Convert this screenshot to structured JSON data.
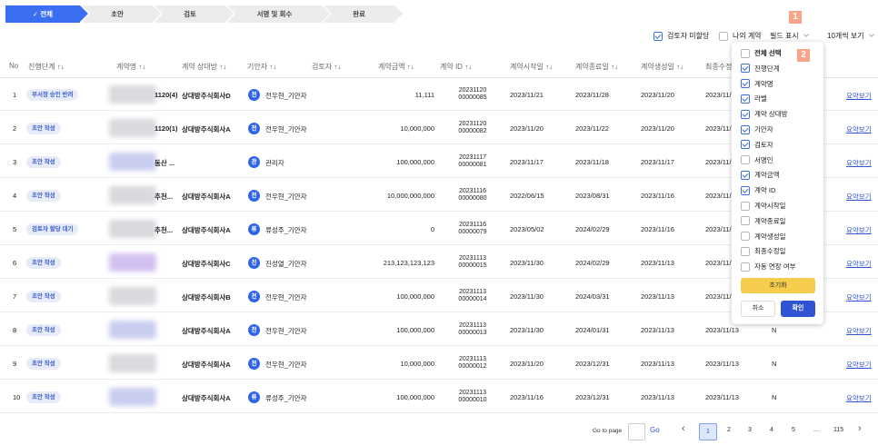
{
  "stepper": {
    "steps": [
      {
        "label": "✓ 전체",
        "active": true
      },
      {
        "label": "초안",
        "active": false
      },
      {
        "label": "검토",
        "active": false
      },
      {
        "label": "서명 및 회수",
        "active": false
      },
      {
        "label": "완료",
        "active": false
      }
    ]
  },
  "toolbar": {
    "unassigned_label": "검토자 미할당",
    "my_contracts_label": "나의 계약",
    "field_display_label": "필드 표시",
    "page_size_label": "10개씩 보기",
    "annotation_1": "1",
    "annotation_2": "2"
  },
  "table": {
    "headers": [
      "No",
      "진행단계 ↑↓",
      "계약명 ↑↓",
      "계약 상대방 ↑↓",
      "기안자 ↑↓",
      "검토자 ↑↓",
      "계약금액 ↑↓",
      "계약 ID ↑↓",
      "계약시작일 ↑↓",
      "계약종료일 ↑↓",
      "계약생성일 ↑↓",
      "최종수정"
    ],
    "rows": [
      {
        "no": "1",
        "stage": "부서장 승인 반려",
        "name": "1120(4)",
        "party": "상대방주식회사D",
        "drafter_initial": "전",
        "drafter": "전우현_기안자",
        "amount": "11,111",
        "id1": "20231120",
        "id2": "00000085",
        "start": "2023/11/21",
        "end": "2023/11/28",
        "created": "2023/11/20",
        "modified": "2023/11/",
        "extra": "",
        "action": "요약보기"
      },
      {
        "no": "2",
        "stage": "초안 작성",
        "name": "1120(1)",
        "party": "상대방주식회사A",
        "drafter_initial": "전",
        "drafter": "전우현_기안자",
        "amount": "10,000,000",
        "id1": "20231120",
        "id2": "00000082",
        "start": "2023/11/20",
        "end": "2023/11/22",
        "created": "2023/11/20",
        "modified": "2023/11/",
        "extra": "",
        "action": "요약보기"
      },
      {
        "no": "3",
        "stage": "초안 작성",
        "name": "동산 ...",
        "party": "",
        "drafter_initial": "관",
        "drafter": "관리자",
        "amount": "100,000,000",
        "id1": "20231117",
        "id2": "00000081",
        "start": "2023/11/17",
        "end": "2023/11/18",
        "created": "2023/11/17",
        "modified": "2023/11/",
        "extra": "",
        "action": "요약보기"
      },
      {
        "no": "4",
        "stage": "초안 작성",
        "name": "추천...",
        "party": "상대방주식회사A",
        "drafter_initial": "전",
        "drafter": "전우현_기안자",
        "amount": "10,000,000,000",
        "id1": "20231116",
        "id2": "00000080",
        "start": "2022/06/15",
        "end": "2023/08/31",
        "created": "2023/11/16",
        "modified": "2023/11/",
        "extra": "",
        "action": "요약보기"
      },
      {
        "no": "5",
        "stage": "검토자 할당 대기",
        "name": "추천...",
        "party": "상대방주식회사A",
        "drafter_initial": "류",
        "drafter": "류성주_기안자",
        "amount": "0",
        "id1": "20231116",
        "id2": "00000079",
        "start": "2023/05/02",
        "end": "2024/02/29",
        "created": "2023/11/16",
        "modified": "2023/11/",
        "extra": "",
        "action": "요약보기"
      },
      {
        "no": "6",
        "stage": "초안 작성",
        "name": "",
        "party": "상대방주식회사C",
        "drafter_initial": "진",
        "drafter": "진성열_기안자",
        "amount": "213,123,123,123",
        "id1": "20231113",
        "id2": "00000015",
        "start": "2023/11/30",
        "end": "2024/02/29",
        "created": "2023/11/13",
        "modified": "2023/11/",
        "extra": "",
        "action": "요약보기"
      },
      {
        "no": "7",
        "stage": "초안 작성",
        "name": "",
        "party": "상대방주식회사B",
        "drafter_initial": "전",
        "drafter": "전우현_기안자",
        "amount": "100,000,000",
        "id1": "20231113",
        "id2": "00000014",
        "start": "2023/11/30",
        "end": "2024/03/31",
        "created": "2023/11/13",
        "modified": "2023/11/",
        "extra": "",
        "action": "요약보기"
      },
      {
        "no": "8",
        "stage": "초안 작성",
        "name": "",
        "party": "상대방주식회사A",
        "drafter_initial": "전",
        "drafter": "전우현_기안자",
        "amount": "100,000,000",
        "id1": "20231113",
        "id2": "00000013",
        "start": "2023/11/30",
        "end": "2024/01/31",
        "created": "2023/11/13",
        "modified": "2023/11/13",
        "extra": "N",
        "action": "요약보기"
      },
      {
        "no": "9",
        "stage": "초안 작성",
        "name": "",
        "party": "상대방주식회사A",
        "drafter_initial": "전",
        "drafter": "전우현_기안자",
        "amount": "10,000,000",
        "id1": "20231113",
        "id2": "00000012",
        "start": "2023/11/20",
        "end": "2023/12/31",
        "created": "2023/11/13",
        "modified": "2023/11/13",
        "extra": "N",
        "action": "요약보기"
      },
      {
        "no": "10",
        "stage": "초안 작성",
        "name": "",
        "party": "상대방주식회사A",
        "drafter_initial": "류",
        "drafter": "류성주_기안자",
        "amount": "100,000,000",
        "id1": "20231113",
        "id2": "00000010",
        "start": "2023/11/16",
        "end": "2023/12/31",
        "created": "2023/11/13",
        "modified": "2023/11/13",
        "extra": "N",
        "action": "요약보기"
      }
    ]
  },
  "field_dropdown": {
    "items": [
      {
        "label": "전체 선택",
        "checked": false,
        "bold": true
      },
      {
        "label": "진행단계",
        "checked": true
      },
      {
        "label": "계약명",
        "checked": true
      },
      {
        "label": "라벨",
        "checked": true
      },
      {
        "label": "계약 상대방",
        "checked": true
      },
      {
        "label": "기안자",
        "checked": true
      },
      {
        "label": "검토자",
        "checked": true
      },
      {
        "label": "서명인",
        "checked": false
      },
      {
        "label": "계약금액",
        "checked": true
      },
      {
        "label": "계약 ID",
        "checked": true
      },
      {
        "label": "계약시작일",
        "checked": false
      },
      {
        "label": "계약종료일",
        "checked": false
      },
      {
        "label": "계약생성일",
        "checked": false
      },
      {
        "label": "최종수정일",
        "checked": false
      },
      {
        "label": "자동 연장 여부",
        "checked": false
      }
    ],
    "reset_label": "초기화",
    "cancel_label": "취소",
    "confirm_label": "확인"
  },
  "pagination": {
    "goto_label": "Go to page",
    "go_label": "Go",
    "prev": "‹",
    "next": "›",
    "pages": [
      "1",
      "2",
      "3",
      "4",
      "5",
      "...",
      "115"
    ],
    "current": "1"
  },
  "colors": {
    "accent": "#3b6ff2",
    "pill_bg": "#e8ecf9",
    "reset_button": "#f5cc4b",
    "annotation": "#f8a38a"
  }
}
